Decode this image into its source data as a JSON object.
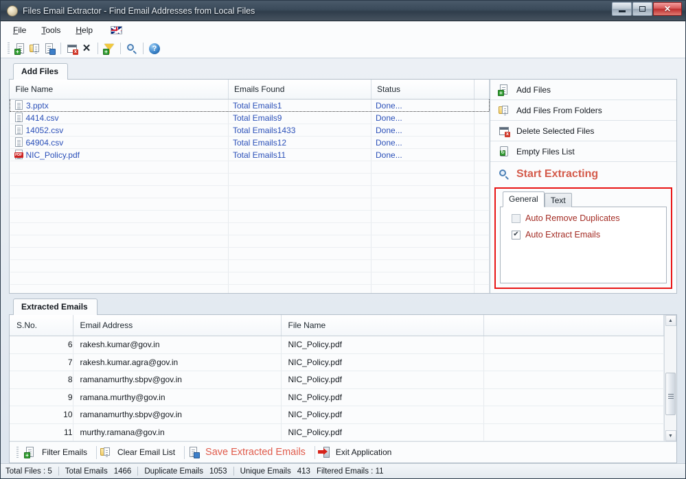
{
  "window": {
    "title": "Files Email Extractor -  Find Email Addresses from Local Files",
    "icon": "app-icon",
    "controls": {
      "minimize": "–",
      "maximize": "□",
      "close": "✕"
    }
  },
  "menubar": {
    "items": [
      {
        "label": "File",
        "mnemonic": "F"
      },
      {
        "label": "Tools",
        "mnemonic": "T"
      },
      {
        "label": "Help",
        "mnemonic": "H"
      }
    ],
    "flag": "uk-flag-icon"
  },
  "toolbar": {
    "buttons": [
      {
        "name": "add-files-icon",
        "glyph": ""
      },
      {
        "name": "add-files-from-folders-icon",
        "glyph": ""
      },
      {
        "name": "save-icon",
        "glyph": ""
      },
      {
        "name": "delete-selected-files-icon",
        "glyph": ""
      },
      {
        "name": "close-icon",
        "glyph": "✕"
      },
      {
        "name": "filter-icon",
        "glyph": ""
      },
      {
        "name": "search-icon",
        "glyph": ""
      },
      {
        "name": "help-icon",
        "glyph": "?"
      }
    ]
  },
  "tabs": {
    "add_files": "Add Files",
    "extracted_emails": "Extracted Emails"
  },
  "files_table": {
    "columns": [
      "File Name",
      "Emails Found",
      "Status"
    ],
    "rows": [
      {
        "file": "3.pptx",
        "type": "pptx",
        "emails": "Total Emails1",
        "status": "Done..."
      },
      {
        "file": "4414.csv",
        "type": "csv",
        "emails": "Total Emails9",
        "status": "Done..."
      },
      {
        "file": "14052.csv",
        "type": "csv",
        "emails": "Total Emails1433",
        "status": "Done..."
      },
      {
        "file": "64904.csv",
        "type": "csv",
        "emails": "Total Emails12",
        "status": "Done..."
      },
      {
        "file": "NIC_Policy.pdf",
        "type": "pdf",
        "emails": "Total Emails11",
        "status": "Done..."
      }
    ],
    "empty_rows": 11
  },
  "actions": {
    "items": [
      {
        "label": "Add Files",
        "icon": "add-files-icon"
      },
      {
        "label": "Add Files From Folders",
        "icon": "folder-icon"
      },
      {
        "label": "Delete Selected Files",
        "icon": "delete-icon"
      },
      {
        "label": "Empty Files List",
        "icon": "recycle-icon"
      }
    ],
    "start_extracting": "Start Extracting",
    "start_extracting_icon": "search-icon",
    "accent_color": "#d45a4a",
    "highlight_border_color": "#e81313"
  },
  "settings": {
    "tabs": [
      {
        "label": "General",
        "active": true
      },
      {
        "label": "Text",
        "active": false
      }
    ],
    "checkboxes": [
      {
        "label": "Auto Remove Duplicates",
        "checked": false,
        "mark": ""
      },
      {
        "label": "Auto Extract Emails",
        "checked": true,
        "mark": "✔"
      }
    ],
    "label_color": "#a32b23"
  },
  "emails_table": {
    "columns": [
      "S.No.",
      "Email Address",
      "File Name",
      ""
    ],
    "rows": [
      {
        "no": "6",
        "email": "rakesh.kumar@gov.in",
        "file": "NIC_Policy.pdf"
      },
      {
        "no": "7",
        "email": "rakesh.kumar.agra@gov.in",
        "file": "NIC_Policy.pdf"
      },
      {
        "no": "8",
        "email": "ramanamurthy.sbpv@gov.in",
        "file": "NIC_Policy.pdf"
      },
      {
        "no": "9",
        "email": "ramana.murthy@gov.in",
        "file": "NIC_Policy.pdf"
      },
      {
        "no": "10",
        "email": "ramanamurthy.sbpv@gov.in",
        "file": "NIC_Policy.pdf"
      },
      {
        "no": "11",
        "email": "murthy.ramana@gov.in",
        "file": "NIC_Policy.pdf"
      }
    ],
    "scroll": {
      "up": "▲",
      "down": "▼"
    }
  },
  "bottom_toolbar": {
    "filter_emails": "Filter Emails",
    "clear_email_list": "Clear Email List",
    "save_extracted_emails": "Save Extracted Emails",
    "exit_application": "Exit Application",
    "save_color": "#e05a4a"
  },
  "statusbar": {
    "total_files": "Total Files :  5",
    "total_emails_label": "Total Emails",
    "total_emails_value": "1466",
    "duplicate_emails_label": "Duplicate Emails",
    "duplicate_emails_value": "1053",
    "unique_emails_label": "Unique Emails",
    "unique_emails_value": "413",
    "filtered_emails": "Filtered Emails :  11"
  }
}
